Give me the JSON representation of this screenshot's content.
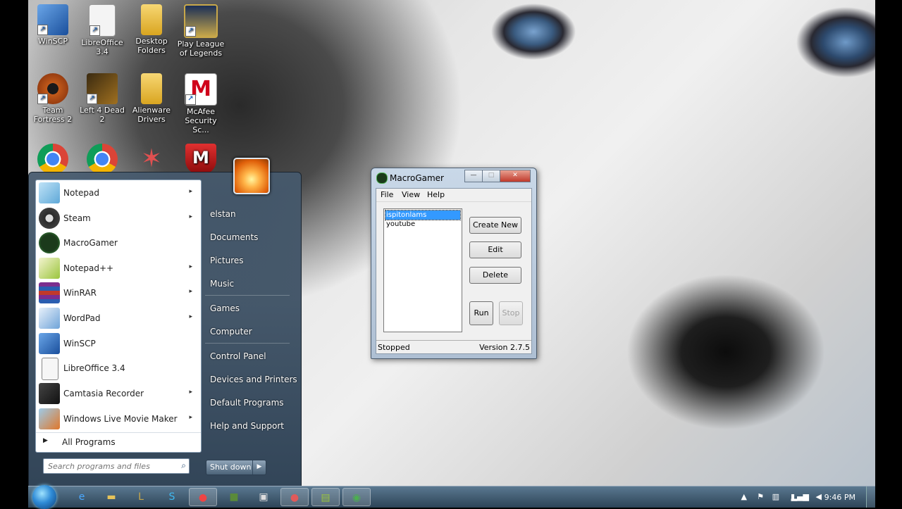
{
  "desktop": {
    "icons": [
      {
        "label": "WinSCP",
        "icon": "winscp-icon"
      },
      {
        "label": "LibreOffice 3.4",
        "icon": "libreoffice-icon"
      },
      {
        "label": "Desktop Folders",
        "icon": "folder-icon"
      },
      {
        "label": "Play League of Legends",
        "icon": "league-of-legends-icon"
      },
      {
        "label": "Team Fortress 2",
        "icon": "team-fortress-icon"
      },
      {
        "label": "Left 4 Dead 2",
        "icon": "left4dead-icon"
      },
      {
        "label": "Alienware Drivers",
        "icon": "folder-icon"
      },
      {
        "label": "McAfee Security Sc...",
        "icon": "mcafee-icon"
      }
    ]
  },
  "start_menu": {
    "programs": [
      {
        "label": "Notepad",
        "icon": "notepad-icon",
        "has_submenu": "▸"
      },
      {
        "label": "Steam",
        "icon": "steam-icon",
        "has_submenu": "▸"
      },
      {
        "label": "MacroGamer",
        "icon": "macrogamer-icon",
        "has_submenu": ""
      },
      {
        "label": "Notepad++",
        "icon": "notepadpp-icon",
        "has_submenu": "▸"
      },
      {
        "label": "WinRAR",
        "icon": "winrar-icon",
        "has_submenu": "▸"
      },
      {
        "label": "WordPad",
        "icon": "wordpad-icon",
        "has_submenu": "▸"
      },
      {
        "label": "WinSCP",
        "icon": "winscp-icon",
        "has_submenu": ""
      },
      {
        "label": "LibreOffice 3.4",
        "icon": "libreoffice-icon",
        "has_submenu": ""
      },
      {
        "label": "Camtasia Recorder",
        "icon": "camtasia-icon",
        "has_submenu": "▸"
      },
      {
        "label": "Windows Live Movie Maker",
        "icon": "moviemaker-icon",
        "has_submenu": "▸"
      }
    ],
    "all_programs": "All Programs",
    "search_placeholder": "Search programs and files",
    "right_links": [
      "elstan",
      "Documents",
      "Pictures",
      "Music",
      "Games",
      "Computer",
      "Control Panel",
      "Devices and Printers",
      "Default Programs",
      "Help and Support"
    ],
    "shutdown_label": "Shut down"
  },
  "window": {
    "title": "MacroGamer",
    "menu": [
      "File",
      "View",
      "Help"
    ],
    "macros": [
      "ispitonlams",
      "youtube"
    ],
    "buttons": {
      "create": "Create New",
      "edit": "Edit",
      "delete": "Delete",
      "run": "Run",
      "stop": "Stop"
    },
    "status": "Stopped",
    "version": "Version 2.7.5"
  },
  "taskbar": {
    "clock": "9:46 PM",
    "apps": [
      "internet-explorer-icon",
      "explorer-icon",
      "league-icon",
      "skype-icon",
      "chrome-icon",
      "minecraft-icon",
      "terminal-icon",
      "recorder-icon",
      "notepadpp-icon",
      "macrogamer-icon"
    ]
  }
}
